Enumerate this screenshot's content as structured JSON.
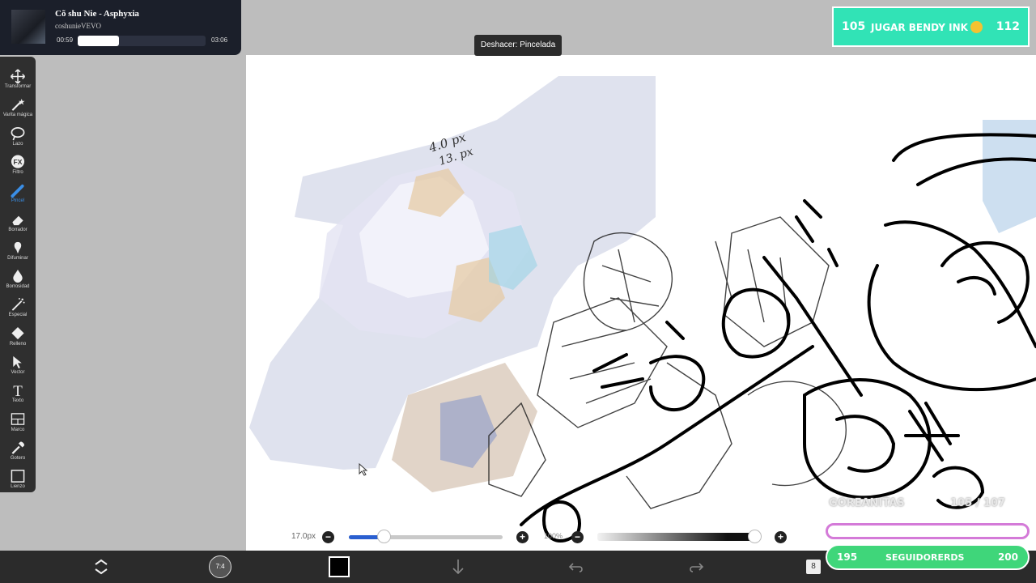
{
  "music": {
    "title": "Cõ shu Nie - Asphyxia",
    "artist": "coshunieVEVO",
    "elapsed": "00:59",
    "duration": "03:06",
    "progress": 0.32
  },
  "tooltip": "Deshacer: Pincelada",
  "banner": {
    "left": "105",
    "text": "JUGAR BENDY INK",
    "right": "112"
  },
  "toolbar": {
    "tools": [
      {
        "label": "Transformar",
        "icon": "move-icon"
      },
      {
        "label": "Varita mágica",
        "icon": "magic-wand-icon"
      },
      {
        "label": "Lazo",
        "icon": "lasso-icon"
      },
      {
        "label": "Filtro",
        "icon": "fx-icon",
        "icon_text": "FX"
      },
      {
        "label": "Pincel",
        "icon": "brush-icon",
        "active": true
      },
      {
        "label": "Borrador",
        "icon": "eraser-icon"
      },
      {
        "label": "Difuminar",
        "icon": "smudge-icon"
      },
      {
        "label": "Borrosidad",
        "icon": "blur-drop-icon"
      },
      {
        "label": "Especial",
        "icon": "special-brush-icon"
      },
      {
        "label": "Relleno",
        "icon": "fill-icon"
      },
      {
        "label": "Vector",
        "icon": "vector-cursor-icon"
      },
      {
        "label": "Texto",
        "icon": "text-icon",
        "icon_text": "T"
      },
      {
        "label": "Marco",
        "icon": "frame-icon"
      },
      {
        "label": "Gotero",
        "icon": "eyedropper-icon"
      },
      {
        "label": "Lienzo",
        "icon": "canvas-icon"
      }
    ]
  },
  "canvas_notes": {
    "line1": "4.0 px",
    "line2": "13. px"
  },
  "brush": {
    "size": "17.0px",
    "size_fraction": 0.22,
    "opacity": "100%",
    "opacity_fraction": 0.97
  },
  "bottombar": {
    "layer_count": "8",
    "avatar_text": "7:4"
  },
  "overlay": {
    "goal_label": "GOREANITAS",
    "goal_count": "105 / 107",
    "subs_left": "195",
    "subs_text": "SEGUIDORERDS",
    "subs_right": "200"
  },
  "colors": {
    "accent": "#2a5fd0",
    "banner": "#31e3b6",
    "subs": "#3fd67a",
    "goal_border": "#d47ad8",
    "current_color": "#000000"
  }
}
